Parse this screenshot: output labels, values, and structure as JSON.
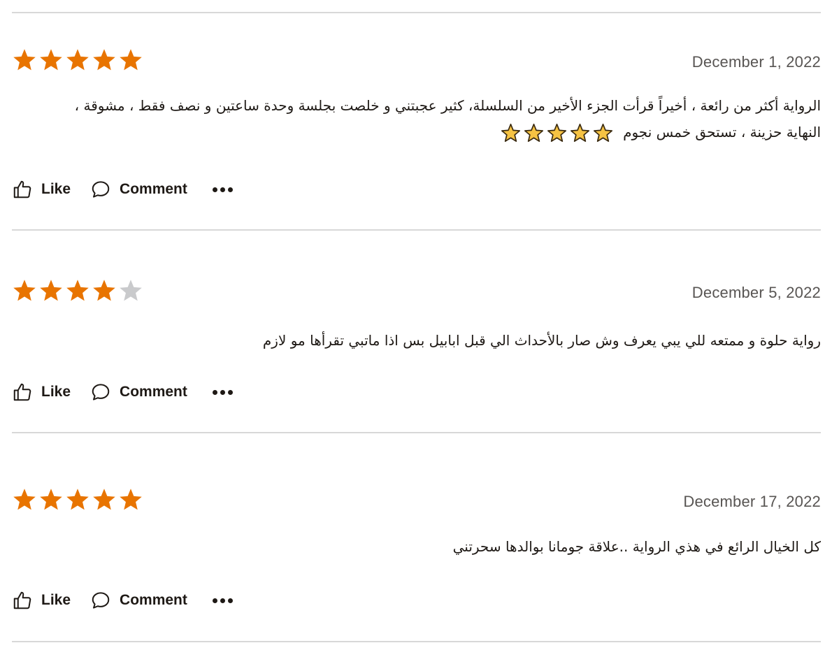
{
  "colors": {
    "star_filled": "#e87400",
    "star_empty": "#c9cacc",
    "emoji_star": "#f6c343",
    "divider": "#d8d8d8"
  },
  "actions": {
    "like_label": "Like",
    "comment_label": "Comment",
    "more_icon": "more-dots-icon"
  },
  "reviews": [
    {
      "rating": 5,
      "max_rating": 5,
      "date": "December 1, 2022",
      "text_line1": "الرواية أكثر من رائعة ، أخيراً قرأت الجزء الأخير من السلسلة، كثير عجبتني و خلصت بجلسة وحدة ساعتين و نصف فقط ، مشوقة ،",
      "text_line2": "النهاية حزينة ، تستحق خمس نجوم",
      "emoji_stars": 5
    },
    {
      "rating": 4,
      "max_rating": 5,
      "date": "December 5, 2022",
      "text_line1": "رواية حلوة و ممتعه للي يبي يعرف وش صار بالأحداث الي قبل ابابيل بس اذا ماتبي تقرأها مو لازم"
    },
    {
      "rating": 5,
      "max_rating": 5,
      "date": "December 17, 2022",
      "text_line1": "كل الخيال الرائع في هذي الرواية ..علاقة جومانا بوالدها سحرتني"
    }
  ]
}
